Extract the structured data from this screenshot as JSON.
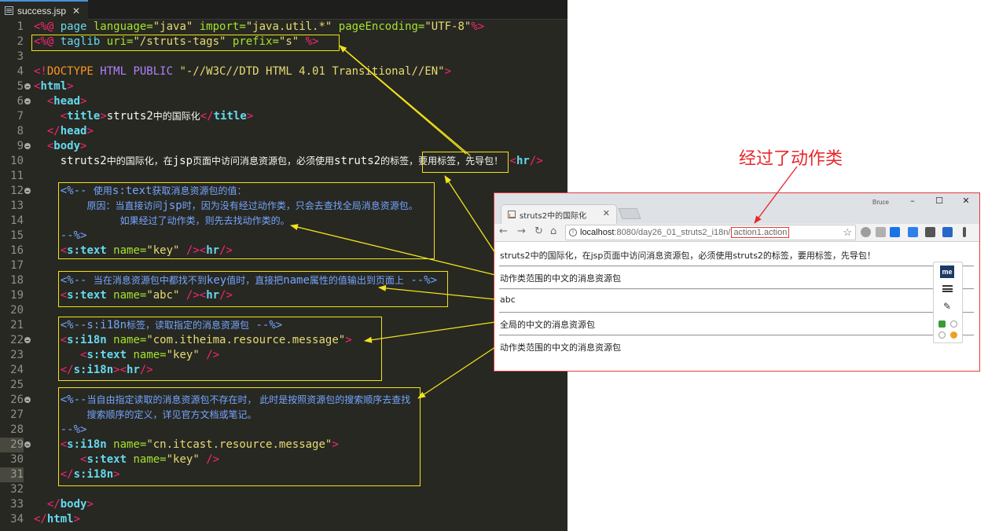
{
  "editor": {
    "tab": {
      "title": "success.jsp",
      "close": "✕"
    },
    "lines": [
      {
        "n": "1",
        "fold": false,
        "mark": false,
        "tokens": [
          [
            "dir",
            "<%@ "
          ],
          [
            "kw",
            "page "
          ],
          [
            "at",
            "language="
          ],
          [
            "st",
            "\"java\" "
          ],
          [
            "at",
            "import="
          ],
          [
            "st",
            "\"java.util.*\" "
          ],
          [
            "at",
            "pageEncoding="
          ],
          [
            "st",
            "\"UTF-8\""
          ],
          [
            "dir",
            "%>"
          ]
        ]
      },
      {
        "n": "2",
        "fold": false,
        "mark": false,
        "tokens": [
          [
            "dir",
            "<%@ "
          ],
          [
            "kw",
            "taglib "
          ],
          [
            "at",
            "uri="
          ],
          [
            "st",
            "\"/struts-tags\" "
          ],
          [
            "at",
            "prefix="
          ],
          [
            "st",
            "\"s\" "
          ],
          [
            "dir",
            "%>"
          ]
        ]
      },
      {
        "n": "3",
        "fold": false,
        "mark": false,
        "tokens": []
      },
      {
        "n": "4",
        "fold": false,
        "mark": false,
        "tokens": [
          [
            "dir",
            "<!"
          ],
          [
            "dt",
            "DOCTYPE "
          ],
          [
            "pb",
            "HTML PUBLIC "
          ],
          [
            "st",
            "\"-//W3C//DTD HTML 4.01 Transitional//EN\""
          ],
          [
            "dir",
            ">"
          ]
        ]
      },
      {
        "n": "5",
        "fold": true,
        "mark": false,
        "tokens": [
          [
            "dir",
            "<"
          ],
          [
            "tg",
            "html"
          ],
          [
            "dir",
            ">"
          ]
        ]
      },
      {
        "n": "6",
        "fold": true,
        "mark": false,
        "tokens": [
          [
            "pl",
            "  "
          ],
          [
            "dir",
            "<"
          ],
          [
            "tg",
            "head"
          ],
          [
            "dir",
            ">"
          ]
        ]
      },
      {
        "n": "7",
        "fold": false,
        "mark": false,
        "tokens": [
          [
            "pl",
            "    "
          ],
          [
            "dir",
            "<"
          ],
          [
            "tg",
            "title"
          ],
          [
            "dir",
            ">"
          ],
          [
            "pl",
            "struts2"
          ],
          [
            "plc",
            "中的国际化"
          ],
          [
            "dir",
            "</"
          ],
          [
            "tg",
            "title"
          ],
          [
            "dir",
            ">"
          ]
        ]
      },
      {
        "n": "8",
        "fold": false,
        "mark": false,
        "tokens": [
          [
            "pl",
            "  "
          ],
          [
            "dir",
            "</"
          ],
          [
            "tg",
            "head"
          ],
          [
            "dir",
            ">"
          ]
        ]
      },
      {
        "n": "9",
        "fold": true,
        "mark": false,
        "tokens": [
          [
            "pl",
            "  "
          ],
          [
            "dir",
            "<"
          ],
          [
            "tg",
            "body"
          ],
          [
            "dir",
            ">"
          ]
        ]
      },
      {
        "n": "10",
        "fold": false,
        "mark": false,
        "tokens": [
          [
            "pl",
            "    struts2"
          ],
          [
            "plc",
            "中的国际化，在"
          ],
          [
            "pl",
            "jsp"
          ],
          [
            "plc",
            "页面中访问消息资源包，必须使用"
          ],
          [
            "pl",
            "struts2"
          ],
          [
            "plc",
            "的标签，要用标签，先导包！"
          ],
          [
            "pl",
            " "
          ],
          [
            "dir",
            "<"
          ],
          [
            "tg",
            "hr"
          ],
          [
            "dir",
            "/>"
          ]
        ]
      },
      {
        "n": "11",
        "fold": false,
        "mark": false,
        "tokens": []
      },
      {
        "n": "12",
        "fold": true,
        "mark": false,
        "tokens": [
          [
            "pl",
            "    "
          ],
          [
            "cm",
            "<%-- "
          ],
          [
            "cmc",
            "使用"
          ],
          [
            "cm",
            "s:text"
          ],
          [
            "cmc",
            "获取消息资源包的值："
          ]
        ]
      },
      {
        "n": "13",
        "fold": false,
        "mark": false,
        "tokens": [
          [
            "pl",
            "        "
          ],
          [
            "cmc",
            "原因：当直接访问"
          ],
          [
            "cm",
            "jsp"
          ],
          [
            "cmc",
            "时，因为没有经过动作类，只会去查找全局消息资源包。"
          ]
        ]
      },
      {
        "n": "14",
        "fold": false,
        "mark": false,
        "tokens": [
          [
            "pl",
            "             "
          ],
          [
            "cmc",
            "如果经过了动作类，则先去找动作类的。"
          ]
        ]
      },
      {
        "n": "15",
        "fold": false,
        "mark": false,
        "tokens": [
          [
            "pl",
            "    "
          ],
          [
            "cm",
            "--%>"
          ]
        ]
      },
      {
        "n": "16",
        "fold": false,
        "mark": false,
        "tokens": [
          [
            "pl",
            "    "
          ],
          [
            "dir",
            "<"
          ],
          [
            "tg",
            "s:text "
          ],
          [
            "at",
            "name="
          ],
          [
            "st",
            "\"key\" "
          ],
          [
            "dir",
            "/><"
          ],
          [
            "tg",
            "hr"
          ],
          [
            "dir",
            "/>"
          ]
        ]
      },
      {
        "n": "17",
        "fold": false,
        "mark": false,
        "tokens": []
      },
      {
        "n": "18",
        "fold": false,
        "mark": false,
        "tokens": [
          [
            "pl",
            "    "
          ],
          [
            "cm",
            "<%-- "
          ],
          [
            "cmc",
            "当在消息资源包中都找不到"
          ],
          [
            "cm",
            "key"
          ],
          [
            "cmc",
            "值时，直接把"
          ],
          [
            "cm",
            "name"
          ],
          [
            "cmc",
            "属性的值输出到页面上"
          ],
          [
            "cm",
            " --%>"
          ]
        ]
      },
      {
        "n": "19",
        "fold": false,
        "mark": false,
        "tokens": [
          [
            "pl",
            "    "
          ],
          [
            "dir",
            "<"
          ],
          [
            "tg",
            "s:text "
          ],
          [
            "at",
            "name="
          ],
          [
            "st",
            "\"abc\" "
          ],
          [
            "dir",
            "/><"
          ],
          [
            "tg",
            "hr"
          ],
          [
            "dir",
            "/>"
          ]
        ]
      },
      {
        "n": "20",
        "fold": false,
        "mark": false,
        "tokens": []
      },
      {
        "n": "21",
        "fold": false,
        "mark": false,
        "tokens": [
          [
            "pl",
            "    "
          ],
          [
            "cm",
            "<%--s:i18n"
          ],
          [
            "cmc",
            "标签，读取指定的消息资源包"
          ],
          [
            "cm",
            " --%>"
          ]
        ]
      },
      {
        "n": "22",
        "fold": true,
        "mark": false,
        "tokens": [
          [
            "pl",
            "    "
          ],
          [
            "dir",
            "<"
          ],
          [
            "tg",
            "s:i18n "
          ],
          [
            "at",
            "name="
          ],
          [
            "st",
            "\"com.itheima.resource.message\""
          ],
          [
            "dir",
            ">"
          ]
        ]
      },
      {
        "n": "23",
        "fold": false,
        "mark": false,
        "tokens": [
          [
            "pl",
            "       "
          ],
          [
            "dir",
            "<"
          ],
          [
            "tg",
            "s:text "
          ],
          [
            "at",
            "name="
          ],
          [
            "st",
            "\"key\" "
          ],
          [
            "dir",
            "/>"
          ]
        ]
      },
      {
        "n": "24",
        "fold": false,
        "mark": false,
        "tokens": [
          [
            "pl",
            "    "
          ],
          [
            "dir",
            "</"
          ],
          [
            "tg",
            "s:i18n"
          ],
          [
            "dir",
            "><"
          ],
          [
            "tg",
            "hr"
          ],
          [
            "dir",
            "/>"
          ]
        ]
      },
      {
        "n": "25",
        "fold": false,
        "mark": false,
        "tokens": []
      },
      {
        "n": "26",
        "fold": true,
        "mark": false,
        "tokens": [
          [
            "pl",
            "    "
          ],
          [
            "cm",
            "<%--"
          ],
          [
            "cmc",
            "当自由指定读取的消息资源包不存在时， 此时是按照资源包的搜索顺序去查找"
          ]
        ]
      },
      {
        "n": "27",
        "fold": false,
        "mark": false,
        "tokens": [
          [
            "pl",
            "        "
          ],
          [
            "cmc",
            "搜索顺序的定义，详见官方文档或笔记。"
          ]
        ]
      },
      {
        "n": "28",
        "fold": false,
        "mark": false,
        "tokens": [
          [
            "pl",
            "    "
          ],
          [
            "cm",
            "--%>"
          ]
        ]
      },
      {
        "n": "29",
        "fold": true,
        "mark": true,
        "tokens": [
          [
            "pl",
            "    "
          ],
          [
            "dir",
            "<"
          ],
          [
            "tg",
            "s:i18n "
          ],
          [
            "at",
            "name="
          ],
          [
            "st",
            "\"cn.itcast.resource.message\""
          ],
          [
            "dir",
            ">"
          ]
        ]
      },
      {
        "n": "30",
        "fold": false,
        "mark": false,
        "tokens": [
          [
            "pl",
            "       "
          ],
          [
            "dir",
            "<"
          ],
          [
            "tg",
            "s:text "
          ],
          [
            "at",
            "name="
          ],
          [
            "st",
            "\"key\" "
          ],
          [
            "dir",
            "/>"
          ]
        ]
      },
      {
        "n": "31",
        "fold": false,
        "mark": true,
        "tokens": [
          [
            "pl",
            "    "
          ],
          [
            "dir",
            "</"
          ],
          [
            "tg",
            "s:i18n"
          ],
          [
            "dir",
            ">"
          ]
        ]
      },
      {
        "n": "32",
        "fold": false,
        "mark": false,
        "tokens": []
      },
      {
        "n": "33",
        "fold": false,
        "mark": false,
        "tokens": [
          [
            "pl",
            "  "
          ],
          [
            "dir",
            "</"
          ],
          [
            "tg",
            "body"
          ],
          [
            "dir",
            ">"
          ]
        ]
      },
      {
        "n": "34",
        "fold": false,
        "mark": false,
        "tokens": [
          [
            "dir",
            "</"
          ],
          [
            "tg",
            "html"
          ],
          [
            "dir",
            ">"
          ]
        ]
      }
    ]
  },
  "callout": "经过了动作类",
  "browser": {
    "tab_title": "struts2中的国际化",
    "tab_close": "✕",
    "user": "Bruce",
    "window_buttons": [
      "–",
      "☐",
      "✕"
    ],
    "nav": {
      "back": "←",
      "forward": "→",
      "reload": "↻",
      "home": "⌂"
    },
    "address": {
      "info": "i",
      "host": "localhost",
      "path": ":8080/day26_01_struts2_i18n/",
      "highlight": "action1.action",
      "star": "☆"
    },
    "content": [
      "struts2中的国际化，在jsp页面中访问消息资源包，必须使用struts2的标签，要用标签，先导包！",
      "动作类范围的中文的消息资源包",
      "abc",
      "全局的中文的消息资源包",
      "动作类范围的中文的消息资源包"
    ],
    "ext_panel": {
      "me_label": "me"
    },
    "colors": {
      "highlight_border": "#f1e21b",
      "callout": "#e8262b",
      "frame": "#e33a3a"
    }
  }
}
